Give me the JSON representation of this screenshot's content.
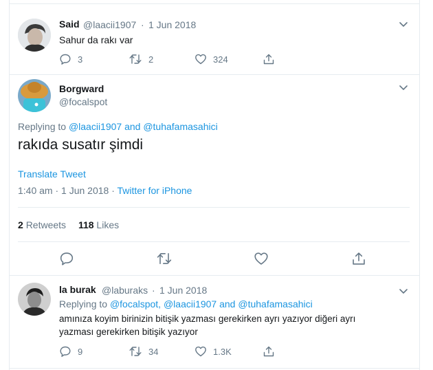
{
  "tweet1": {
    "name": "Said",
    "handle": "@laacii1907",
    "date": "1 Jun 2018",
    "text": "Sahur da rakı var",
    "replies": "3",
    "retweets": "2",
    "likes": "324"
  },
  "tweet2": {
    "name": "Borgward",
    "handle": "@focalspot",
    "replying_prefix": "Replying to",
    "replying_mentions": "@laacii1907 and @tuhafamasahici",
    "text": "rakıda susatır şimdi",
    "translate": "Translate Tweet",
    "timestamp": "1:40 am · 1 Jun 2018 · ",
    "source": "Twitter for iPhone",
    "retweet_count": "2",
    "retweet_label": "Retweets",
    "like_count": "118",
    "like_label": "Likes"
  },
  "tweet3": {
    "name": "la burak",
    "handle": "@laburaks",
    "date": "1 Jun 2018",
    "replying_prefix": "Replying to",
    "replying_mentions": "@focalspot, @laacii1907 and @tuhafamasahici",
    "text_line1": "amınıza koyim birinizin bitişik yazması gerekirken ayrı yazıyor diğeri ayrı",
    "text_line2": "yazması gerekirken bitişik yazıyor",
    "replies": "9",
    "retweets": "34",
    "likes": "1.3K"
  },
  "icons": [
    "reply-icon",
    "retweet-icon",
    "like-icon",
    "share-icon",
    "chevron-down-icon"
  ],
  "colors": {
    "link": "#1b95e0",
    "muted": "#657786",
    "text": "#14171a",
    "border": "#e6ecf0"
  }
}
